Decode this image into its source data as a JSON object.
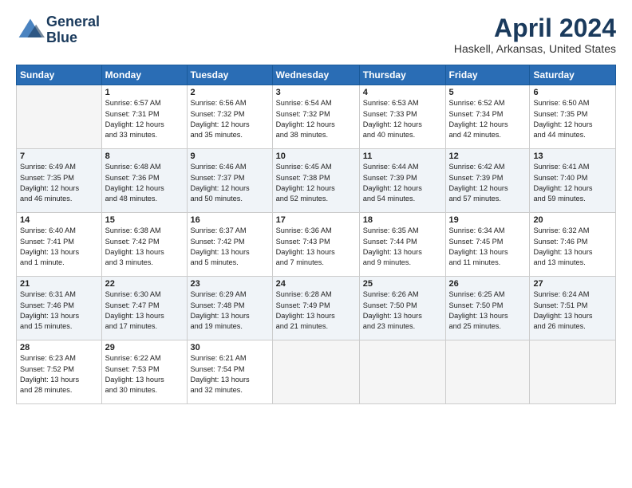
{
  "header": {
    "logo_line1": "General",
    "logo_line2": "Blue",
    "main_title": "April 2024",
    "sub_title": "Haskell, Arkansas, United States"
  },
  "weekdays": [
    "Sunday",
    "Monday",
    "Tuesday",
    "Wednesday",
    "Thursday",
    "Friday",
    "Saturday"
  ],
  "weeks": [
    [
      {
        "num": "",
        "info": ""
      },
      {
        "num": "1",
        "info": "Sunrise: 6:57 AM\nSunset: 7:31 PM\nDaylight: 12 hours\nand 33 minutes."
      },
      {
        "num": "2",
        "info": "Sunrise: 6:56 AM\nSunset: 7:32 PM\nDaylight: 12 hours\nand 35 minutes."
      },
      {
        "num": "3",
        "info": "Sunrise: 6:54 AM\nSunset: 7:32 PM\nDaylight: 12 hours\nand 38 minutes."
      },
      {
        "num": "4",
        "info": "Sunrise: 6:53 AM\nSunset: 7:33 PM\nDaylight: 12 hours\nand 40 minutes."
      },
      {
        "num": "5",
        "info": "Sunrise: 6:52 AM\nSunset: 7:34 PM\nDaylight: 12 hours\nand 42 minutes."
      },
      {
        "num": "6",
        "info": "Sunrise: 6:50 AM\nSunset: 7:35 PM\nDaylight: 12 hours\nand 44 minutes."
      }
    ],
    [
      {
        "num": "7",
        "info": "Sunrise: 6:49 AM\nSunset: 7:35 PM\nDaylight: 12 hours\nand 46 minutes."
      },
      {
        "num": "8",
        "info": "Sunrise: 6:48 AM\nSunset: 7:36 PM\nDaylight: 12 hours\nand 48 minutes."
      },
      {
        "num": "9",
        "info": "Sunrise: 6:46 AM\nSunset: 7:37 PM\nDaylight: 12 hours\nand 50 minutes."
      },
      {
        "num": "10",
        "info": "Sunrise: 6:45 AM\nSunset: 7:38 PM\nDaylight: 12 hours\nand 52 minutes."
      },
      {
        "num": "11",
        "info": "Sunrise: 6:44 AM\nSunset: 7:39 PM\nDaylight: 12 hours\nand 54 minutes."
      },
      {
        "num": "12",
        "info": "Sunrise: 6:42 AM\nSunset: 7:39 PM\nDaylight: 12 hours\nand 57 minutes."
      },
      {
        "num": "13",
        "info": "Sunrise: 6:41 AM\nSunset: 7:40 PM\nDaylight: 12 hours\nand 59 minutes."
      }
    ],
    [
      {
        "num": "14",
        "info": "Sunrise: 6:40 AM\nSunset: 7:41 PM\nDaylight: 13 hours\nand 1 minute."
      },
      {
        "num": "15",
        "info": "Sunrise: 6:38 AM\nSunset: 7:42 PM\nDaylight: 13 hours\nand 3 minutes."
      },
      {
        "num": "16",
        "info": "Sunrise: 6:37 AM\nSunset: 7:42 PM\nDaylight: 13 hours\nand 5 minutes."
      },
      {
        "num": "17",
        "info": "Sunrise: 6:36 AM\nSunset: 7:43 PM\nDaylight: 13 hours\nand 7 minutes."
      },
      {
        "num": "18",
        "info": "Sunrise: 6:35 AM\nSunset: 7:44 PM\nDaylight: 13 hours\nand 9 minutes."
      },
      {
        "num": "19",
        "info": "Sunrise: 6:34 AM\nSunset: 7:45 PM\nDaylight: 13 hours\nand 11 minutes."
      },
      {
        "num": "20",
        "info": "Sunrise: 6:32 AM\nSunset: 7:46 PM\nDaylight: 13 hours\nand 13 minutes."
      }
    ],
    [
      {
        "num": "21",
        "info": "Sunrise: 6:31 AM\nSunset: 7:46 PM\nDaylight: 13 hours\nand 15 minutes."
      },
      {
        "num": "22",
        "info": "Sunrise: 6:30 AM\nSunset: 7:47 PM\nDaylight: 13 hours\nand 17 minutes."
      },
      {
        "num": "23",
        "info": "Sunrise: 6:29 AM\nSunset: 7:48 PM\nDaylight: 13 hours\nand 19 minutes."
      },
      {
        "num": "24",
        "info": "Sunrise: 6:28 AM\nSunset: 7:49 PM\nDaylight: 13 hours\nand 21 minutes."
      },
      {
        "num": "25",
        "info": "Sunrise: 6:26 AM\nSunset: 7:50 PM\nDaylight: 13 hours\nand 23 minutes."
      },
      {
        "num": "26",
        "info": "Sunrise: 6:25 AM\nSunset: 7:50 PM\nDaylight: 13 hours\nand 25 minutes."
      },
      {
        "num": "27",
        "info": "Sunrise: 6:24 AM\nSunset: 7:51 PM\nDaylight: 13 hours\nand 26 minutes."
      }
    ],
    [
      {
        "num": "28",
        "info": "Sunrise: 6:23 AM\nSunset: 7:52 PM\nDaylight: 13 hours\nand 28 minutes."
      },
      {
        "num": "29",
        "info": "Sunrise: 6:22 AM\nSunset: 7:53 PM\nDaylight: 13 hours\nand 30 minutes."
      },
      {
        "num": "30",
        "info": "Sunrise: 6:21 AM\nSunset: 7:54 PM\nDaylight: 13 hours\nand 32 minutes."
      },
      {
        "num": "",
        "info": ""
      },
      {
        "num": "",
        "info": ""
      },
      {
        "num": "",
        "info": ""
      },
      {
        "num": "",
        "info": ""
      }
    ]
  ]
}
